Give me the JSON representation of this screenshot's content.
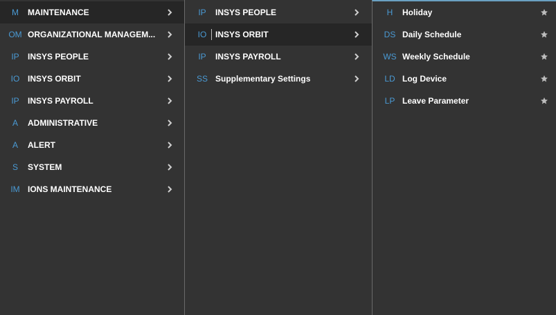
{
  "col1": {
    "items": [
      {
        "abbr": "M",
        "label": "MAINTENANCE"
      },
      {
        "abbr": "OM",
        "label": "ORGANIZATIONAL MANAGEM..."
      },
      {
        "abbr": "IP",
        "label": "INSYS PEOPLE"
      },
      {
        "abbr": "IO",
        "label": "INSYS ORBIT"
      },
      {
        "abbr": "IP",
        "label": "INSYS PAYROLL"
      },
      {
        "abbr": "A",
        "label": "ADMINISTRATIVE"
      },
      {
        "abbr": "A",
        "label": "ALERT"
      },
      {
        "abbr": "S",
        "label": "SYSTEM"
      },
      {
        "abbr": "IM",
        "label": "IONS MAINTENANCE"
      }
    ]
  },
  "col2": {
    "items": [
      {
        "abbr": "IP",
        "label": "INSYS PEOPLE"
      },
      {
        "abbr": "IO",
        "label": "INSYS ORBIT"
      },
      {
        "abbr": "IP",
        "label": "INSYS PAYROLL"
      },
      {
        "abbr": "SS",
        "label": "Supplementary Settings"
      }
    ]
  },
  "col3": {
    "items": [
      {
        "abbr": "H",
        "label": "Holiday"
      },
      {
        "abbr": "DS",
        "label": "Daily Schedule"
      },
      {
        "abbr": "WS",
        "label": "Weekly Schedule"
      },
      {
        "abbr": "LD",
        "label": "Log Device"
      },
      {
        "abbr": "LP",
        "label": "Leave Parameter"
      }
    ]
  },
  "icons": {
    "chevron": "chevron-right-icon",
    "favorite": "star-icon"
  },
  "colors": {
    "background": "#333333",
    "active_row": "#262626",
    "abbr": "#4a9ad4",
    "accent_top": "#6aa0c2"
  }
}
